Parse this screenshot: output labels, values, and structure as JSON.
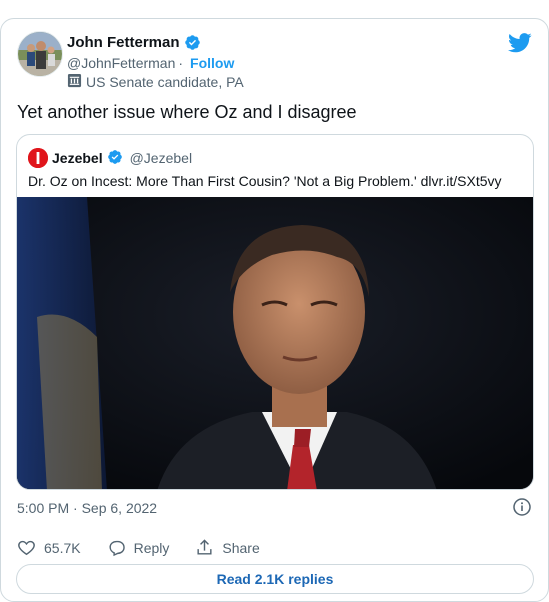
{
  "tweet": {
    "author_name": "John Fetterman",
    "handle": "@JohnFetterman",
    "separator": "·",
    "follow_label": "Follow",
    "account_label": "US Senate candidate, PA",
    "text": "Yet another issue where Oz and I disagree",
    "timestamp": "5:00 PM · Sep 6, 2022",
    "likes": "65.7K",
    "reply_label": "Reply",
    "share_label": "Share",
    "read_replies_label": "Read 2.1K replies"
  },
  "quote": {
    "name": "Jezebel",
    "handle": "@Jezebel",
    "text": "Dr. Oz on Incest: More Than First Cousin? 'Not a Big Problem.' dlvr.it/SXt5vy"
  },
  "colors": {
    "accent": "#1d9bf0",
    "text": "#0f1419",
    "muted": "#536471",
    "border": "#cfd9de",
    "jezebel_red": "#e0151b"
  },
  "icons": [
    "twitter-bird-icon",
    "verified-badge-icon",
    "government-label-icon",
    "info-icon",
    "heart-icon",
    "reply-icon",
    "share-icon"
  ]
}
